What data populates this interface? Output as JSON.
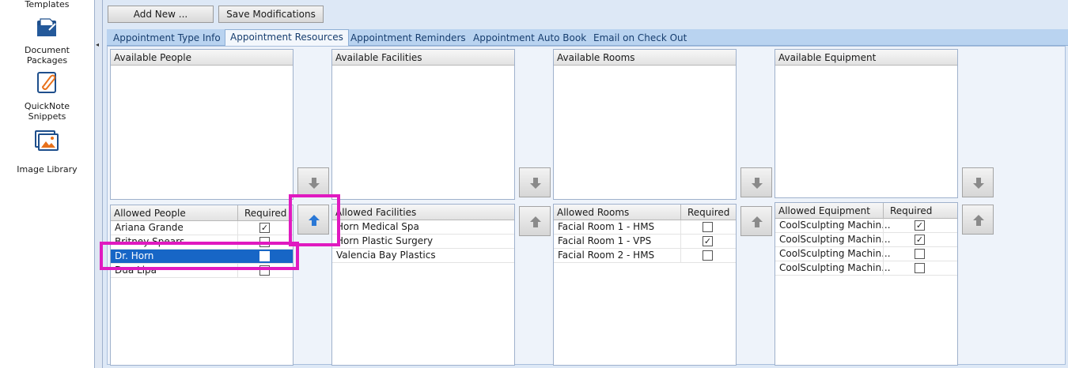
{
  "sidebar": {
    "items": [
      {
        "label": "Templates",
        "icon": "templates-icon"
      },
      {
        "label": "Document Packages",
        "label_line1": "Document",
        "label_line2": "Packages",
        "icon": "document-packages-icon"
      },
      {
        "label": "QuickNote Snippets",
        "label_line1": "QuickNote",
        "label_line2": "Snippets",
        "icon": "quicknote-snippets-icon"
      },
      {
        "label": "Image Library",
        "icon": "image-library-icon"
      }
    ],
    "collapse_glyph": "◂"
  },
  "toolbar": {
    "add_new_label": "Add New ...",
    "save_label": "Save Modifications"
  },
  "tabs": [
    {
      "label": "Appointment Type Info",
      "active": false
    },
    {
      "label": "Appointment Resources",
      "active": true
    },
    {
      "label": "Appointment Reminders",
      "active": false
    },
    {
      "label": "Appointment Auto Book",
      "active": false
    },
    {
      "label": "Email on Check Out",
      "active": false
    }
  ],
  "people": {
    "available_header": "Available People",
    "allowed_header": "Allowed People",
    "required_header": "Required",
    "allowed": [
      {
        "name": "Ariana Grande",
        "required": true,
        "selected": false
      },
      {
        "name": "Britney Spears",
        "required": false,
        "selected": false
      },
      {
        "name": "Dr. Horn",
        "required": false,
        "selected": true
      },
      {
        "name": "Dua Lipa",
        "required": false,
        "selected": false
      }
    ]
  },
  "facilities": {
    "available_header": "Available Facilities",
    "allowed_header": "Allowed Facilities",
    "allowed": [
      {
        "name": "Horn Medical Spa"
      },
      {
        "name": "Horn Plastic Surgery"
      },
      {
        "name": "Valencia Bay Plastics"
      }
    ]
  },
  "rooms": {
    "available_header": "Available Rooms",
    "allowed_header": "Allowed Rooms",
    "required_header": "Required",
    "allowed": [
      {
        "name": "Facial Room 1 - HMS",
        "required": false
      },
      {
        "name": "Facial Room 1 - VPS",
        "required": true
      },
      {
        "name": "Facial Room 2 - HMS",
        "required": false
      }
    ]
  },
  "equipment": {
    "available_header": "Available Equipment",
    "allowed_header": "Allowed Equipment",
    "required_header": "Required",
    "allowed": [
      {
        "name": "CoolSculpting Machin...",
        "required": true
      },
      {
        "name": "CoolSculpting Machin...",
        "required": true
      },
      {
        "name": "CoolSculpting Machin...",
        "required": false
      },
      {
        "name": "CoolSculpting Machin...",
        "required": false
      }
    ]
  },
  "check_glyph": "✓",
  "colors": {
    "highlight": "#e01ac0",
    "selection": "#1766c6",
    "tab_text": "#163d6e",
    "up_arrow_active": "#2a78d6",
    "arrow_inactive": "#8a8a8a"
  }
}
